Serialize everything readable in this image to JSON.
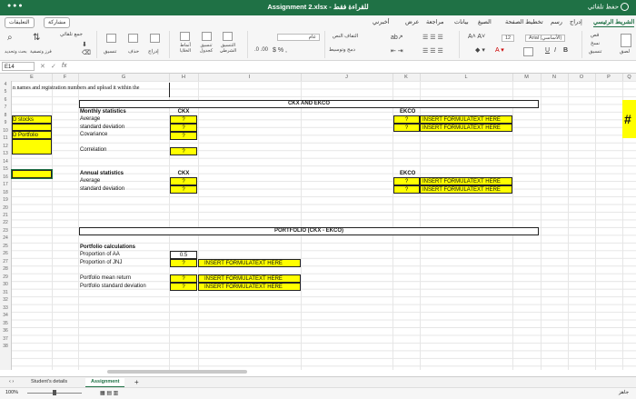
{
  "titlebar": {
    "title": "Assignment 2.xlsx - للقراءة فقط",
    "autosave_label": "حفظ تلقائي",
    "autosave_state": "إيقاف"
  },
  "ribbon_tabs": [
    "الشريط الرئيسي",
    "إدراج",
    "رسم",
    "تخطيط الصفحة",
    "الصيغ",
    "بيانات",
    "مراجعة",
    "عرض",
    "أخبرني"
  ],
  "ribbon_right": {
    "share": "مشاركة",
    "comments": "التعليقات"
  },
  "ribbon": {
    "paste": "لصق",
    "cut": "قص",
    "copy": "نسخ",
    "format": "تنسيق",
    "font_name": "Arial (الأساسي)",
    "font_size": "12",
    "wrap": "التفاف النص",
    "merge": "دمج وتوسيط",
    "number_format": "عام",
    "conditional": "التنسيق الشرطي",
    "as_table": "تنسيق كجدول",
    "cell_styles": "أنماط الخلايا",
    "insert": "إدراج",
    "delete": "حذف",
    "format_cells": "تنسيق",
    "sort": "فرز وتصفية",
    "find": "بحث وتحديد",
    "autosum": "جمع تلقائي"
  },
  "formula_bar": {
    "cell_ref": "E14",
    "fx": "fx",
    "formula": ""
  },
  "columns": [
    "E",
    "F",
    "G",
    "H",
    "I",
    "J",
    "K",
    "L",
    "M",
    "N",
    "O",
    "P",
    "Q"
  ],
  "rows": [
    "4",
    "5",
    "6",
    "7",
    "8",
    "9",
    "10",
    "11",
    "12",
    "13",
    "14",
    "15",
    "16",
    "17",
    "18",
    "19",
    "20",
    "21",
    "22",
    "23",
    "24",
    "25",
    "26",
    "27",
    "28",
    "29",
    "30",
    "31",
    "32",
    "33",
    "34",
    "35",
    "36",
    "37",
    "38"
  ],
  "sheet": {
    "row4_text": "n names and registration numbers and upload it within the",
    "e7": "D stocks",
    "e9": "D Portfolio",
    "ckx_ekco_header": "CKX AND EKCO",
    "monthly_stats": "Monthly statistics",
    "average": "Average",
    "std_dev": "standard deviation",
    "covariance": "Covariance",
    "correlation": "Correlation",
    "annual_stats": "Annual statistics",
    "ckx": "CKX",
    "ekco": "EKCO",
    "q": "?",
    "insert_formula": "INSERT FORMULATEXT HERE",
    "portfolio_header": "PORTFOLIO (CKX - EKCO)",
    "portfolio_calcs": "Portfolio calculations",
    "prop_aa": "Proportion of AA",
    "prop_jnj": "Proportion of JNJ",
    "prop_aa_value": "0.5",
    "mean_return": "Portfolio mean return",
    "portfolio_std": "Portfolio standard deviation",
    "q_right": "#"
  },
  "sheet_tabs": [
    "Student's details",
    "Assignment"
  ],
  "status": {
    "zoom": "100%",
    "ready": "جاهز"
  }
}
